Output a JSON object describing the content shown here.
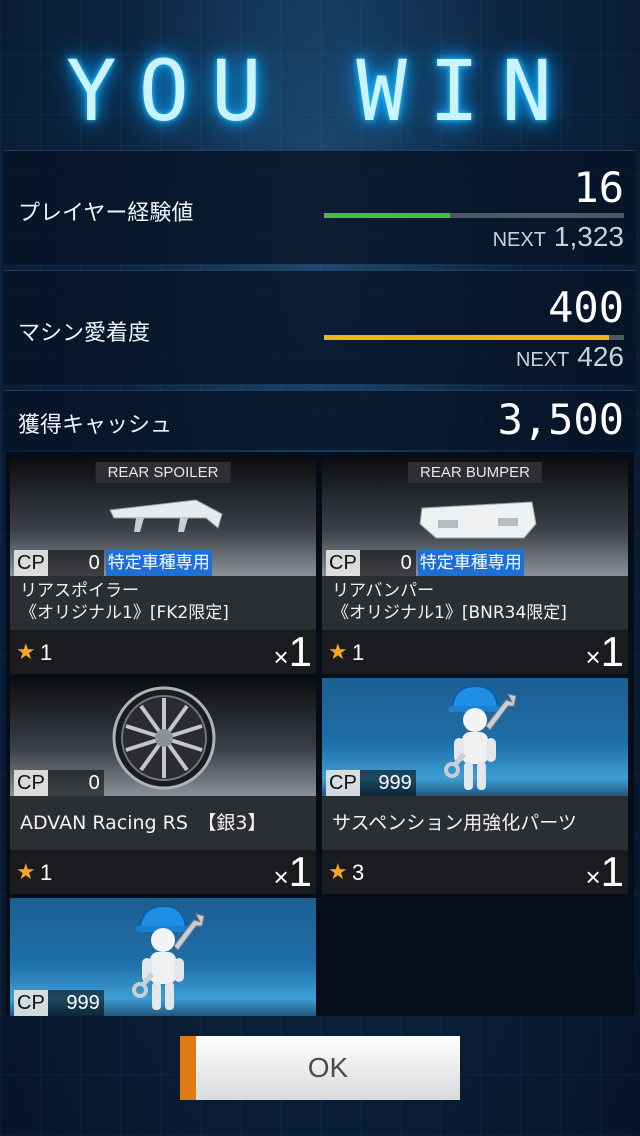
{
  "title": "YOU WIN",
  "stats": {
    "exp": {
      "label": "プレイヤー経験値",
      "value": "16",
      "next_label": "NEXT",
      "next_value": "1,323",
      "progress": 0.42,
      "bar_color": "#3fbf4a"
    },
    "affinity": {
      "label": "マシン愛着度",
      "value": "400",
      "next_label": "NEXT",
      "next_value": "426",
      "progress": 0.95,
      "bar_color": "#f0b419"
    },
    "cash": {
      "label": "獲得キャッシュ",
      "value": "3,500"
    }
  },
  "items": [
    {
      "category": "REAR SPOILER",
      "cp_label": "CP",
      "cp": "0",
      "special": "特定車種専用",
      "name_line1": "リアスポイラー",
      "name_line2": "《オリジナル1》[FK2限定]",
      "stars": "1",
      "qty_prefix": "×",
      "qty": "1",
      "icon": "rear-spoiler-icon"
    },
    {
      "category": "REAR BUMPER",
      "cp_label": "CP",
      "cp": "0",
      "special": "特定車種専用",
      "name_line1": "リアバンパー",
      "name_line2": "《オリジナル1》[BNR34限定]",
      "stars": "1",
      "qty_prefix": "×",
      "qty": "1",
      "icon": "rear-bumper-icon"
    },
    {
      "cp_label": "CP",
      "cp": "0",
      "name": "ADVAN Racing RS　【銀3】",
      "stars": "1",
      "qty_prefix": "×",
      "qty": "1",
      "icon": "wheel-icon"
    },
    {
      "cp_label": "CP",
      "cp": "999",
      "name": "サスペンション用強化パーツ",
      "stars": "3",
      "qty_prefix": "×",
      "qty": "1",
      "icon": "mechanic-icon"
    },
    {
      "cp_label": "CP",
      "cp": "999",
      "icon": "mechanic-icon"
    }
  ],
  "ok_button": "OK",
  "colors": {
    "accent_orange": "#e07a12",
    "title_glow": "#29c8ff",
    "star": "#f5a623",
    "special_badge": "#1b6fd6"
  }
}
